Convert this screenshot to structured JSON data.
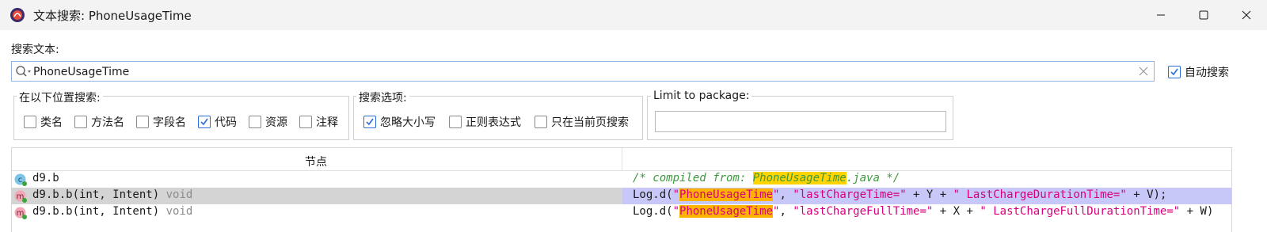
{
  "window": {
    "title": "文本搜索: PhoneUsageTime",
    "icons": [
      "app-logo-icon",
      "minimize-icon",
      "maximize-icon",
      "close-icon"
    ]
  },
  "search": {
    "label": "搜索文本:",
    "value": "PhoneUsageTime",
    "auto_search": {
      "label": "自动搜索",
      "checked": true
    }
  },
  "search_in": {
    "title": "在以下位置搜索:",
    "options": [
      {
        "label": "类名",
        "checked": false
      },
      {
        "label": "方法名",
        "checked": false
      },
      {
        "label": "字段名",
        "checked": false
      },
      {
        "label": "代码",
        "checked": true
      },
      {
        "label": "资源",
        "checked": false
      },
      {
        "label": "注释",
        "checked": false
      }
    ]
  },
  "search_options": {
    "title": "搜索选项:",
    "options": [
      {
        "label": "忽略大小写",
        "checked": true
      },
      {
        "label": "正则表达式",
        "checked": false
      },
      {
        "label": "只在当前页搜索",
        "checked": false
      }
    ]
  },
  "limit_package": {
    "title": "Limit to package:",
    "value": ""
  },
  "results": {
    "column_node": "节点",
    "rows": [
      {
        "icon": "class-c-icon",
        "node": "d9.b",
        "return_type": "",
        "code": {
          "pre": "",
          "match": "PhoneUsageTime",
          "post": ".java */",
          "prefix_comment": "/* compiled from: "
        },
        "selected": false
      },
      {
        "icon": "method-m-icon",
        "node": "d9.b.b(int, Intent)",
        "return_type": "void",
        "code": {
          "prefix": "Log.d(",
          "q1": "\"",
          "match": "PhoneUsageTime",
          "q2": "\"",
          "mid": ", ",
          "str1": "\"lastChargeTime=\"",
          "op1": " + Y + ",
          "str2": "\" LastChargeDurationTime=\"",
          "tail": " + V);"
        },
        "selected": true
      },
      {
        "icon": "method-m-icon",
        "node": "d9.b.b(int, Intent)",
        "return_type": "void",
        "code": {
          "prefix": "Log.d(",
          "q1": "\"",
          "match": "PhoneUsageTime",
          "q2": "\"",
          "mid": ", ",
          "str1": "\"lastChargeFullTime=\"",
          "op1": " + X + ",
          "str2": "\" LastChargeFullDurationTime=\"",
          "tail": " + W)"
        },
        "selected": false
      }
    ]
  },
  "colors": {
    "accent": "#2b6fd6",
    "highlight": "#ffb300",
    "comment": "#3c9a3c",
    "string": "#d6007e",
    "selection": "#c8c8f8"
  }
}
